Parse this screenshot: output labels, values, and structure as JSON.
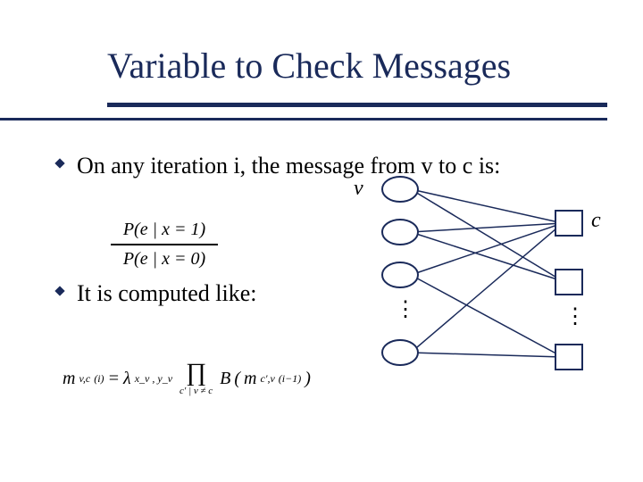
{
  "title": "Variable to Check Messages",
  "bullets": {
    "b1": "On any iteration i, the message from v to c is:",
    "b2": "It is computed like:"
  },
  "fraction": {
    "num": "P(e | x = 1)",
    "den": "P(e | x = 0)"
  },
  "equation": {
    "lhs_m": "m",
    "lhs_sub": "v,c",
    "lhs_sup": "(i)",
    "eq": "=",
    "lambda": "λ",
    "lambda_sub": "x_v , y_v",
    "prod_sym": "∏",
    "prod_sub": "c′ | v ≠ c",
    "B": "B",
    "arg_m": "m",
    "arg_sub": "c′,v",
    "arg_sup": "(i−1)"
  },
  "diagram": {
    "v_label": "v",
    "c_label": "c",
    "ellipsis": "⋮"
  },
  "colors": {
    "accent": "#1a2a5a"
  }
}
